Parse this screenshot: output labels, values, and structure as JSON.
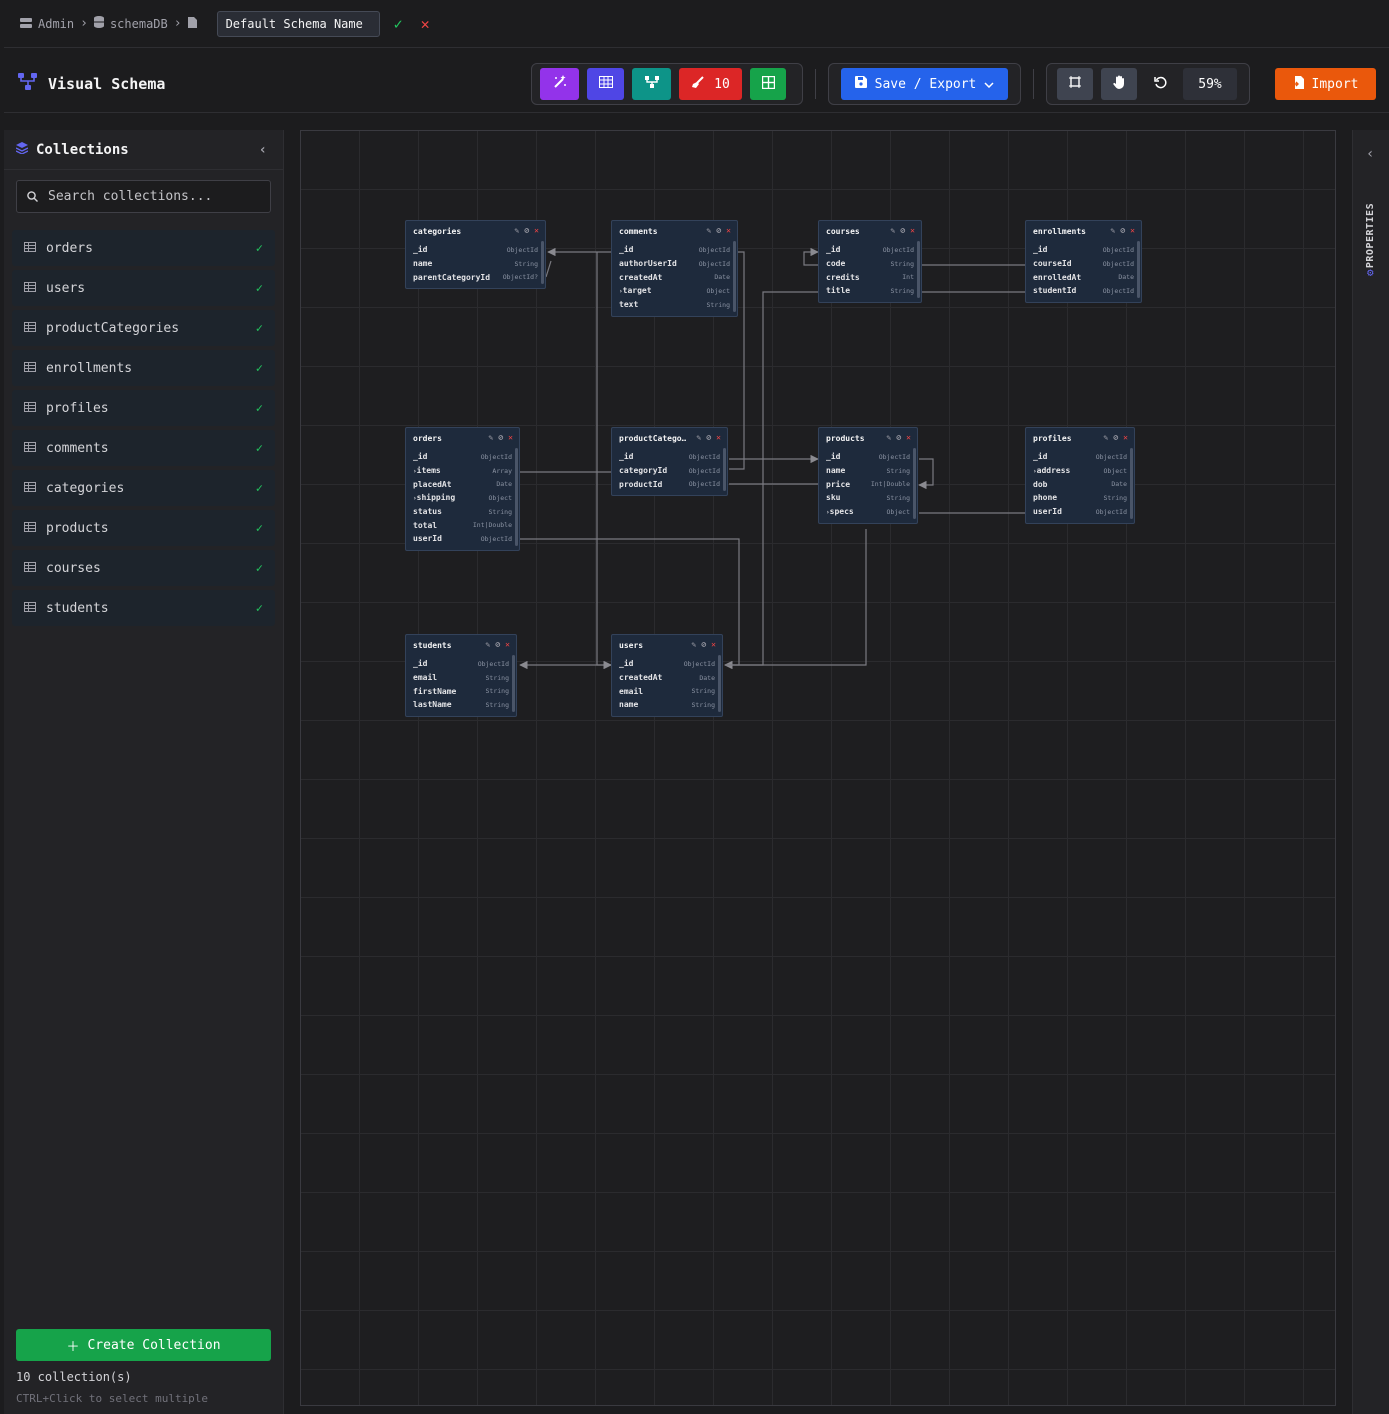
{
  "breadcrumb": {
    "items": [
      "Admin",
      "schemaDB"
    ],
    "schema_name": "Default Schema Name"
  },
  "header": {
    "title": "Visual Schema",
    "count_badge": "10",
    "save_label": "Save / Export",
    "zoom": "59%",
    "import_label": "Import"
  },
  "colors": {
    "wand": "#9333ea",
    "table": "#4f46e5",
    "relations": "#0d9488",
    "clear": "#dc2626",
    "grid": "#16a34a",
    "save": "#2563eb",
    "import": "#ea580c",
    "check": "#22c55e",
    "accent": "#6366f1"
  },
  "sidebar": {
    "title": "Collections",
    "search_placeholder": "Search collections...",
    "items": [
      "orders",
      "users",
      "productCategories",
      "enrollments",
      "profiles",
      "comments",
      "categories",
      "products",
      "courses",
      "students"
    ],
    "create_label": "Create Collection",
    "count_label": "10 collection(s)",
    "hint": "CTRL+Click to select multiple"
  },
  "properties": {
    "label": "PROPERTIES"
  },
  "nodes": [
    {
      "title": "categories",
      "fields": [
        [
          "_id",
          "ObjectId"
        ],
        [
          "name",
          "String"
        ],
        [
          "parentCategoryId",
          "ObjectId?"
        ]
      ]
    },
    {
      "title": "comments",
      "fields": [
        [
          "_id",
          "ObjectId"
        ],
        [
          "authorUserId",
          "ObjectId"
        ],
        [
          "createdAt",
          "Date"
        ],
        [
          "target",
          "Object"
        ],
        [
          "text",
          "String"
        ]
      ]
    },
    {
      "title": "courses",
      "fields": [
        [
          "_id",
          "ObjectId"
        ],
        [
          "code",
          "String"
        ],
        [
          "credits",
          "Int"
        ],
        [
          "title",
          "String"
        ]
      ]
    },
    {
      "title": "enrollments",
      "fields": [
        [
          "_id",
          "ObjectId"
        ],
        [
          "courseId",
          "ObjectId"
        ],
        [
          "enrolledAt",
          "Date"
        ],
        [
          "studentId",
          "ObjectId"
        ]
      ]
    },
    {
      "title": "orders",
      "fields": [
        [
          "_id",
          "ObjectId"
        ],
        [
          "items",
          "Array"
        ],
        [
          "placedAt",
          "Date"
        ],
        [
          "shipping",
          "Object"
        ],
        [
          "status",
          "String"
        ],
        [
          "total",
          "Int|Double"
        ],
        [
          "userId",
          "ObjectId"
        ]
      ]
    },
    {
      "title": "productCatego…",
      "fields": [
        [
          "_id",
          "ObjectId"
        ],
        [
          "categoryId",
          "ObjectId"
        ],
        [
          "productId",
          "ObjectId"
        ]
      ]
    },
    {
      "title": "products",
      "fields": [
        [
          "_id",
          "ObjectId"
        ],
        [
          "name",
          "String"
        ],
        [
          "price",
          "Int|Double"
        ],
        [
          "sku",
          "String"
        ],
        [
          "specs",
          "Object"
        ]
      ]
    },
    {
      "title": "profiles",
      "fields": [
        [
          "_id",
          "ObjectId"
        ],
        [
          "address",
          "Object"
        ],
        [
          "dob",
          "Date"
        ],
        [
          "phone",
          "String"
        ],
        [
          "userId",
          "ObjectId"
        ]
      ]
    },
    {
      "title": "students",
      "fields": [
        [
          "_id",
          "ObjectId"
        ],
        [
          "email",
          "String"
        ],
        [
          "firstName",
          "String"
        ],
        [
          "lastName",
          "String"
        ]
      ]
    },
    {
      "title": "users",
      "fields": [
        [
          "_id",
          "ObjectId"
        ],
        [
          "createdAt",
          "Date"
        ],
        [
          "email",
          "String"
        ],
        [
          "name",
          "String"
        ]
      ]
    }
  ]
}
